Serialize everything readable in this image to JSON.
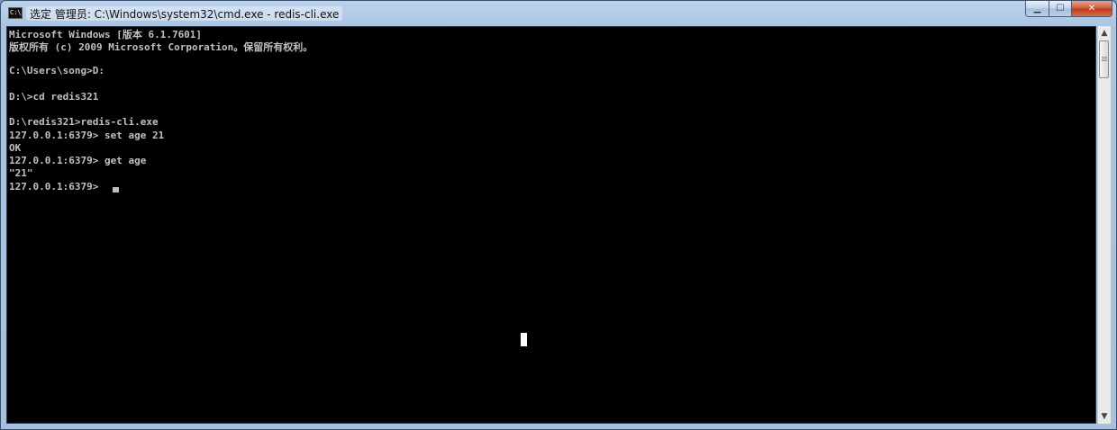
{
  "window": {
    "title": "选定 管理员: C:\\Windows\\system32\\cmd.exe - redis-cli.exe",
    "icon": "cmd-icon",
    "icon_text": "C:\\",
    "buttons": {
      "minimize": "minimize-icon",
      "maximize": "maximize-icon",
      "close": "close-icon"
    }
  },
  "console": {
    "lines": [
      "Microsoft Windows [版本 6.1.7601]",
      "版权所有 (c) 2009 Microsoft Corporation。保留所有权利。",
      "",
      "C:\\Users\\song>D:",
      "",
      "D:\\>cd redis321",
      "",
      "D:\\redis321>redis-cli.exe",
      "127.0.0.1:6379> set age 21",
      "OK",
      "127.0.0.1:6379> get age",
      "\"21\"",
      "127.0.0.1:6379> "
    ]
  },
  "colors": {
    "console_bg": "#000000",
    "console_fg": "#c0c0c0",
    "close_button": "#c23714"
  }
}
